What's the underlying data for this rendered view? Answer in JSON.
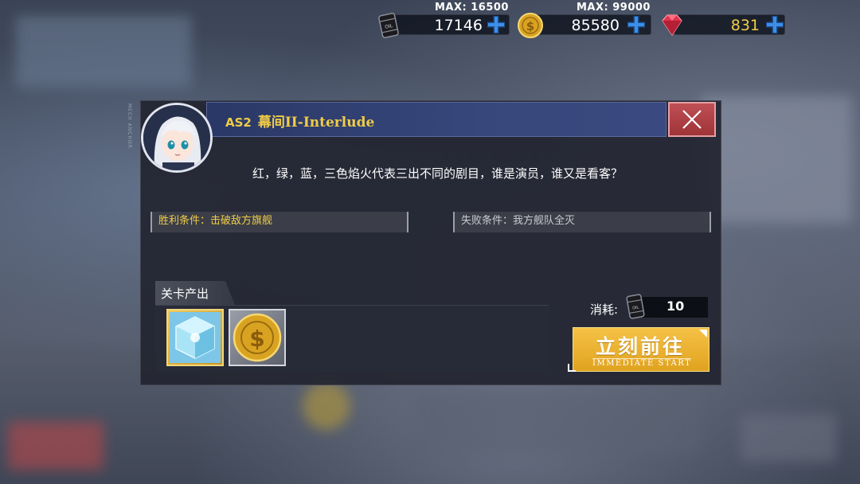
{
  "resources": {
    "oil": {
      "max_label": "MAX: 16500",
      "value": "17146",
      "icon": "oil-barrel-icon"
    },
    "gold": {
      "max_label": "MAX: 99000",
      "value": "85580",
      "icon": "gold-coin-icon"
    },
    "gems": {
      "value": "831",
      "icon": "gem-icon"
    }
  },
  "dialog": {
    "side_text": "MECH ANCHOR",
    "title_prefix": "AS2",
    "title": "幕间II-Interlude",
    "description": "红，绿，蓝，三色焰火代表三出不同的剧目，谁是演员，谁又是看客？",
    "win_condition": "胜利条件：击破敌方旗舰",
    "lose_condition": "失败条件：我方舰队全灭",
    "drops_title": "关卡产出",
    "drops": [
      {
        "name": "cube-item",
        "icon": "cube-icon"
      },
      {
        "name": "coin-item",
        "icon": "coin-icon"
      }
    ],
    "cost_label": "消耗:",
    "cost_value": "10",
    "start_button": {
      "label": "立刻前往",
      "sub_label": "IMMEDIATE START"
    }
  },
  "colors": {
    "title_gold": "#f0cc46",
    "title_bar": "#37477b",
    "close_red": "#b0434a",
    "start_gold": "#e8ae2a"
  }
}
